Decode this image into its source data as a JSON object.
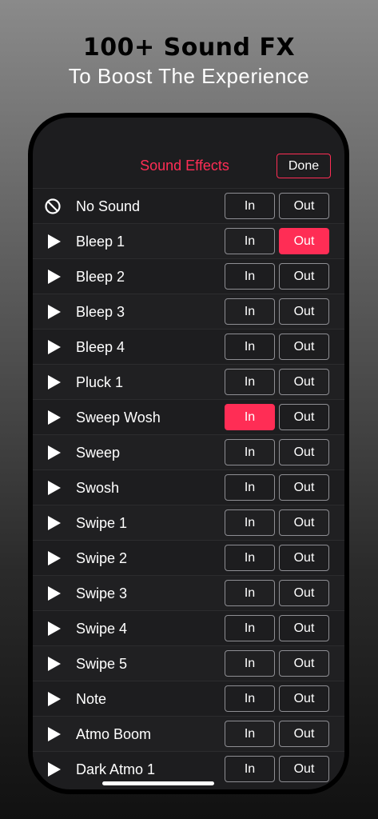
{
  "promo": {
    "title": "100+ Sound FX",
    "subtitle": "To Boost The Experience"
  },
  "nav": {
    "title": "Sound Effects",
    "done_label": "Done"
  },
  "colors": {
    "accent": "#ff2d55",
    "background": "#1d1d1f"
  },
  "rows": [
    {
      "label": "No Sound",
      "icon": "no-sound-icon",
      "in_label": "In",
      "out_label": "Out",
      "in_active": false,
      "out_active": false
    },
    {
      "label": "Bleep 1",
      "icon": "play-icon",
      "in_label": "In",
      "out_label": "Out",
      "in_active": false,
      "out_active": true
    },
    {
      "label": "Bleep 2",
      "icon": "play-icon",
      "in_label": "In",
      "out_label": "Out",
      "in_active": false,
      "out_active": false
    },
    {
      "label": "Bleep 3",
      "icon": "play-icon",
      "in_label": "In",
      "out_label": "Out",
      "in_active": false,
      "out_active": false
    },
    {
      "label": "Bleep 4",
      "icon": "play-icon",
      "in_label": "In",
      "out_label": "Out",
      "in_active": false,
      "out_active": false
    },
    {
      "label": "Pluck 1",
      "icon": "play-icon",
      "in_label": "In",
      "out_label": "Out",
      "in_active": false,
      "out_active": false
    },
    {
      "label": "Sweep Wosh",
      "icon": "play-icon",
      "in_label": "In",
      "out_label": "Out",
      "in_active": true,
      "out_active": false
    },
    {
      "label": "Sweep",
      "icon": "play-icon",
      "in_label": "In",
      "out_label": "Out",
      "in_active": false,
      "out_active": false
    },
    {
      "label": "Swosh",
      "icon": "play-icon",
      "in_label": "In",
      "out_label": "Out",
      "in_active": false,
      "out_active": false
    },
    {
      "label": "Swipe 1",
      "icon": "play-icon",
      "in_label": "In",
      "out_label": "Out",
      "in_active": false,
      "out_active": false
    },
    {
      "label": "Swipe 2",
      "icon": "play-icon",
      "in_label": "In",
      "out_label": "Out",
      "in_active": false,
      "out_active": false
    },
    {
      "label": "Swipe 3",
      "icon": "play-icon",
      "in_label": "In",
      "out_label": "Out",
      "in_active": false,
      "out_active": false
    },
    {
      "label": "Swipe 4",
      "icon": "play-icon",
      "in_label": "In",
      "out_label": "Out",
      "in_active": false,
      "out_active": false
    },
    {
      "label": "Swipe 5",
      "icon": "play-icon",
      "in_label": "In",
      "out_label": "Out",
      "in_active": false,
      "out_active": false
    },
    {
      "label": "Note",
      "icon": "play-icon",
      "in_label": "In",
      "out_label": "Out",
      "in_active": false,
      "out_active": false
    },
    {
      "label": "Atmo Boom",
      "icon": "play-icon",
      "in_label": "In",
      "out_label": "Out",
      "in_active": false,
      "out_active": false
    },
    {
      "label": "Dark Atmo 1",
      "icon": "play-icon",
      "in_label": "In",
      "out_label": "Out",
      "in_active": false,
      "out_active": false
    }
  ]
}
